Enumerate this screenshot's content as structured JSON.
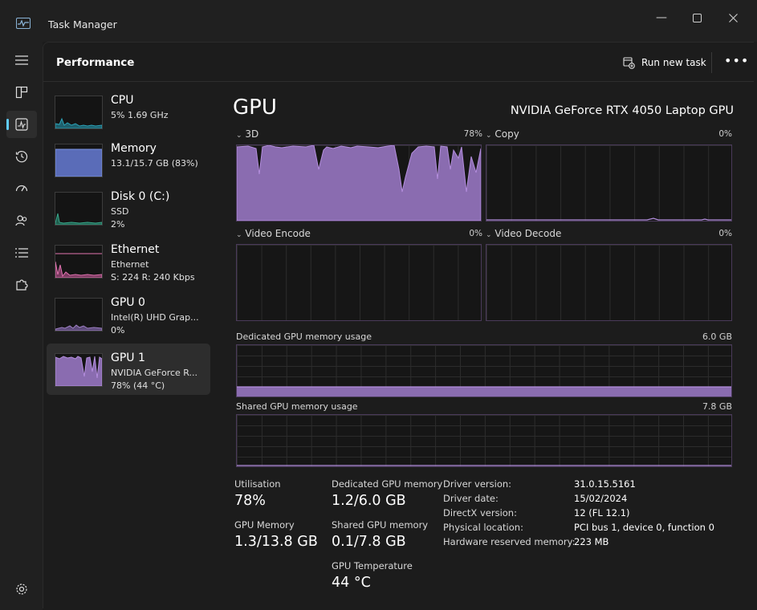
{
  "window": {
    "title": "Task Manager"
  },
  "header": {
    "page_title": "Performance",
    "run_new_task": "Run new task"
  },
  "sidebar": [
    {
      "name": "CPU",
      "line1": "5% 1.69 GHz",
      "line2": ""
    },
    {
      "name": "Memory",
      "line1": "13.1/15.7 GB (83%)",
      "line2": ""
    },
    {
      "name": "Disk 0 (C:)",
      "line1": "SSD",
      "line2": "2%"
    },
    {
      "name": "Ethernet",
      "line1": "Ethernet",
      "line2": "S: 224 R: 240 Kbps"
    },
    {
      "name": "GPU 0",
      "line1": "Intel(R) UHD Grap...",
      "line2": "0%"
    },
    {
      "name": "GPU 1",
      "line1": "NVIDIA GeForce R...",
      "line2": "78% (44 °C)"
    }
  ],
  "main": {
    "title": "GPU",
    "model": "NVIDIA GeForce RTX 4050 Laptop GPU",
    "engines": [
      {
        "label": "3D",
        "value": "78%"
      },
      {
        "label": "Copy",
        "value": "0%"
      },
      {
        "label": "Video Encode",
        "value": "0%"
      },
      {
        "label": "Video Decode",
        "value": "0%"
      }
    ],
    "dedicated_label": "Dedicated GPU memory usage",
    "dedicated_max": "6.0 GB",
    "shared_label": "Shared GPU memory usage",
    "shared_max": "7.8 GB"
  },
  "stats": {
    "utilisation_label": "Utilisation",
    "utilisation_value": "78%",
    "dedicated_label": "Dedicated GPU memory",
    "dedicated_value": "1.2/6.0 GB",
    "gpu_memory_label": "GPU Memory",
    "gpu_memory_value": "1.3/13.8 GB",
    "shared_label": "Shared GPU memory",
    "shared_value": "0.1/7.8 GB",
    "temp_label": "GPU Temperature",
    "temp_value": "44 °C"
  },
  "details": [
    {
      "key": "Driver version:",
      "value": "31.0.15.5161"
    },
    {
      "key": "Driver date:",
      "value": "15/02/2024"
    },
    {
      "key": "DirectX version:",
      "value": "12 (FL 12.1)"
    },
    {
      "key": "Physical location:",
      "value": "PCI bus 1, device 0, function 0"
    },
    {
      "key": "Hardware reserved memory:",
      "value": "223 MB"
    }
  ],
  "colors": {
    "gpu_fill": "#9f80c6",
    "gpu_stroke": "#b48ede",
    "cpu": "#2ba3b8",
    "memory": "#6f88d6",
    "disk": "#3aa98c",
    "ethernet": "#e274b1",
    "accent": "#60cdff"
  }
}
